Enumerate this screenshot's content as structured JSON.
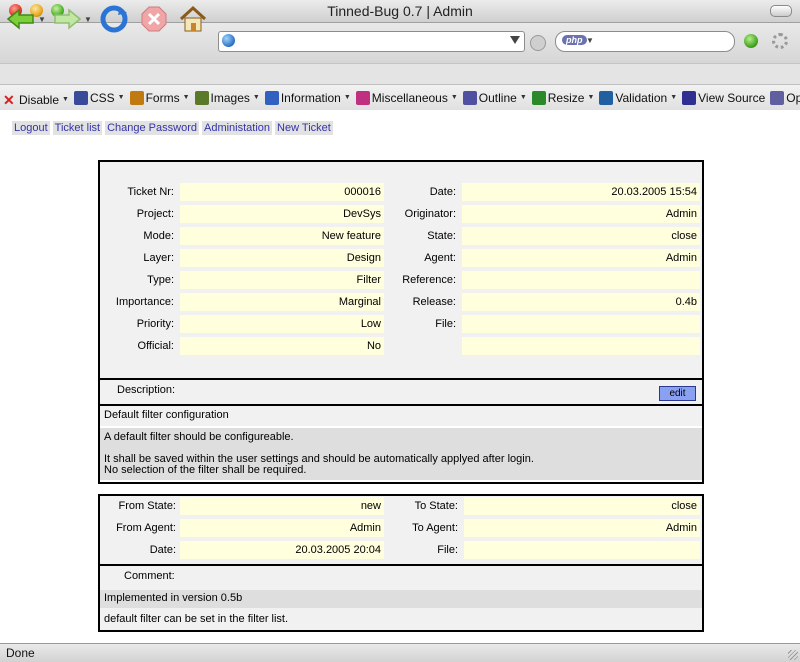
{
  "window": {
    "title": "Tinned-Bug 0.7 | Admin"
  },
  "address": {
    "value": "",
    "search_engine": "php"
  },
  "devbar": [
    {
      "label": "Disable",
      "icon": "red-x-icon"
    },
    {
      "label": "CSS",
      "icon": "css-icon"
    },
    {
      "label": "Forms",
      "icon": "forms-icon"
    },
    {
      "label": "Images",
      "icon": "images-icon"
    },
    {
      "label": "Information",
      "icon": "info-icon"
    },
    {
      "label": "Miscellaneous",
      "icon": "misc-icon"
    },
    {
      "label": "Outline",
      "icon": "outline-icon"
    },
    {
      "label": "Resize",
      "icon": "resize-icon"
    },
    {
      "label": "Validation",
      "icon": "validation-icon"
    },
    {
      "label": "View Source",
      "icon": "view-source-icon"
    },
    {
      "label": "Opt",
      "icon": "options-icon"
    }
  ],
  "menu": {
    "logout": "Logout",
    "ticket_list": "Ticket list",
    "change_password": "Change Password",
    "administation": "Administation",
    "new_ticket": "New Ticket"
  },
  "ticket": {
    "left": [
      {
        "label": "Ticket Nr:",
        "value": "000016"
      },
      {
        "label": "Project:",
        "value": "DevSys"
      },
      {
        "label": "Mode:",
        "value": "New feature"
      },
      {
        "label": "Layer:",
        "value": "Design"
      },
      {
        "label": "Type:",
        "value": "Filter"
      },
      {
        "label": "Importance:",
        "value": "Marginal"
      },
      {
        "label": "Priority:",
        "value": "Low"
      },
      {
        "label": "Official:",
        "value": "No"
      }
    ],
    "right": [
      {
        "label": "Date:",
        "value": "20.03.2005 15:54"
      },
      {
        "label": "Originator:",
        "value": "Admin"
      },
      {
        "label": "State:",
        "value": "close"
      },
      {
        "label": "Agent:",
        "value": "Admin"
      },
      {
        "label": "Reference:",
        "value": ""
      },
      {
        "label": "Release:",
        "value": "0.4b"
      },
      {
        "label": "File:",
        "value": ""
      },
      {
        "label": "",
        "value": ""
      }
    ],
    "description_label": "Description:",
    "edit_label": "edit",
    "summary": "Default filter configuration",
    "body_lines": [
      "A default filter should be configureable.",
      "",
      "It shall be saved within the user settings and should be automatically applyed after login.",
      "No selection of the filter shall be required."
    ]
  },
  "history": {
    "left": [
      {
        "label": "From State:",
        "value": "new"
      },
      {
        "label": "From Agent:",
        "value": "Admin"
      },
      {
        "label": "Date:",
        "value": "20.03.2005 20:04"
      }
    ],
    "right": [
      {
        "label": "To State:",
        "value": "close"
      },
      {
        "label": "To Agent:",
        "value": "Admin"
      },
      {
        "label": "File:",
        "value": ""
      }
    ],
    "comment_label": "Comment:",
    "comment_summary": "Implemented in version 0.5b",
    "comment_body": "default filter can be set in the filter list."
  },
  "status": {
    "text": "Done"
  }
}
